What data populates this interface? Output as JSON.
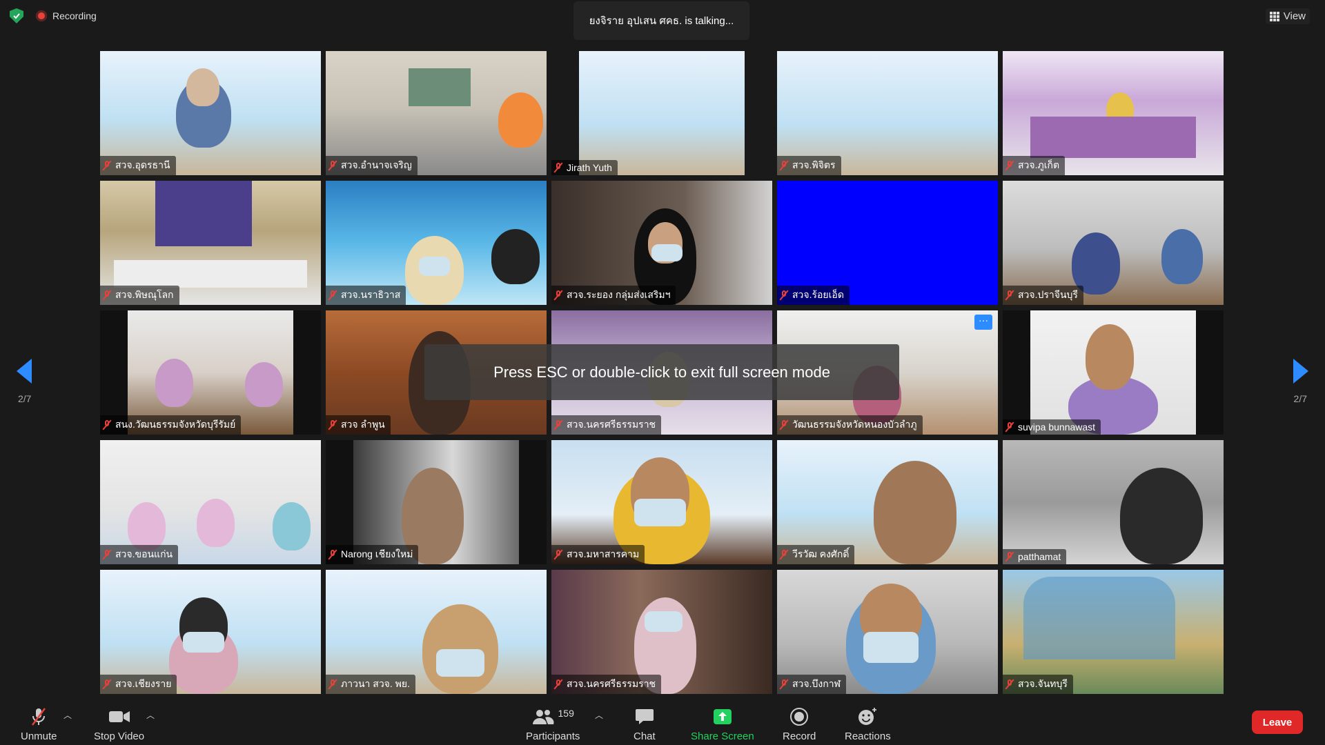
{
  "status": {
    "recording_label": "Recording",
    "talking_banner": "ยงจิราย  อุปเสน ศคธ. is  talking...",
    "view_label": "View"
  },
  "fullscreen_notice": "Press ESC or double-click to exit full screen mode",
  "page_indicator": "2/7",
  "participants": [
    {
      "name": "สวจ.อุดรธานี"
    },
    {
      "name": "สวจ.อำนาจเจริญ"
    },
    {
      "name": "Jirath Yuth"
    },
    {
      "name": "สวจ.พิจิตร"
    },
    {
      "name": "สวจ.ภูเก็ต"
    },
    {
      "name": "สวจ.พิษณุโลก"
    },
    {
      "name": "สวจ.นราธิวาส"
    },
    {
      "name": "สวจ.ระยอง กลุ่มส่งเสริมฯ"
    },
    {
      "name": "สวจ.ร้อยเอ็ด"
    },
    {
      "name": "สวจ.ปราจีนบุรี"
    },
    {
      "name": "สนง.วัฒนธรรมจังหวัดบุรีรัมย์"
    },
    {
      "name": "สวจ ลำพูน"
    },
    {
      "name": "สวจ.นครศรีธรรมราช"
    },
    {
      "name": "วัฒนธรรมจังหวัดหนองบัวลำภู"
    },
    {
      "name": "suvipa bunnawast"
    },
    {
      "name": "สวจ.ขอนแก่น"
    },
    {
      "name": "Narong เชียงใหม่"
    },
    {
      "name": "สวจ.มหาสารคาม"
    },
    {
      "name": "วีรวัฒ คงศักดิ์"
    },
    {
      "name": "patthamat"
    },
    {
      "name": "สวจ.เชียงราย"
    },
    {
      "name": "ภาวนา สวจ. พย."
    },
    {
      "name": "สวจ.นครศรีธรรมราช"
    },
    {
      "name": "สวจ.บึงกาฬ"
    },
    {
      "name": "สวจ.จันทบุรี"
    }
  ],
  "toolbar": {
    "unmute": "Unmute",
    "stop_video": "Stop Video",
    "participants": "Participants",
    "participants_count": "159",
    "chat": "Chat",
    "share_screen": "Share Screen",
    "record": "Record",
    "reactions": "Reactions",
    "leave": "Leave"
  },
  "colors": {
    "accent": "#2d8cff",
    "leave": "#e02828",
    "share": "#23d160",
    "muted": "#e8413a"
  }
}
